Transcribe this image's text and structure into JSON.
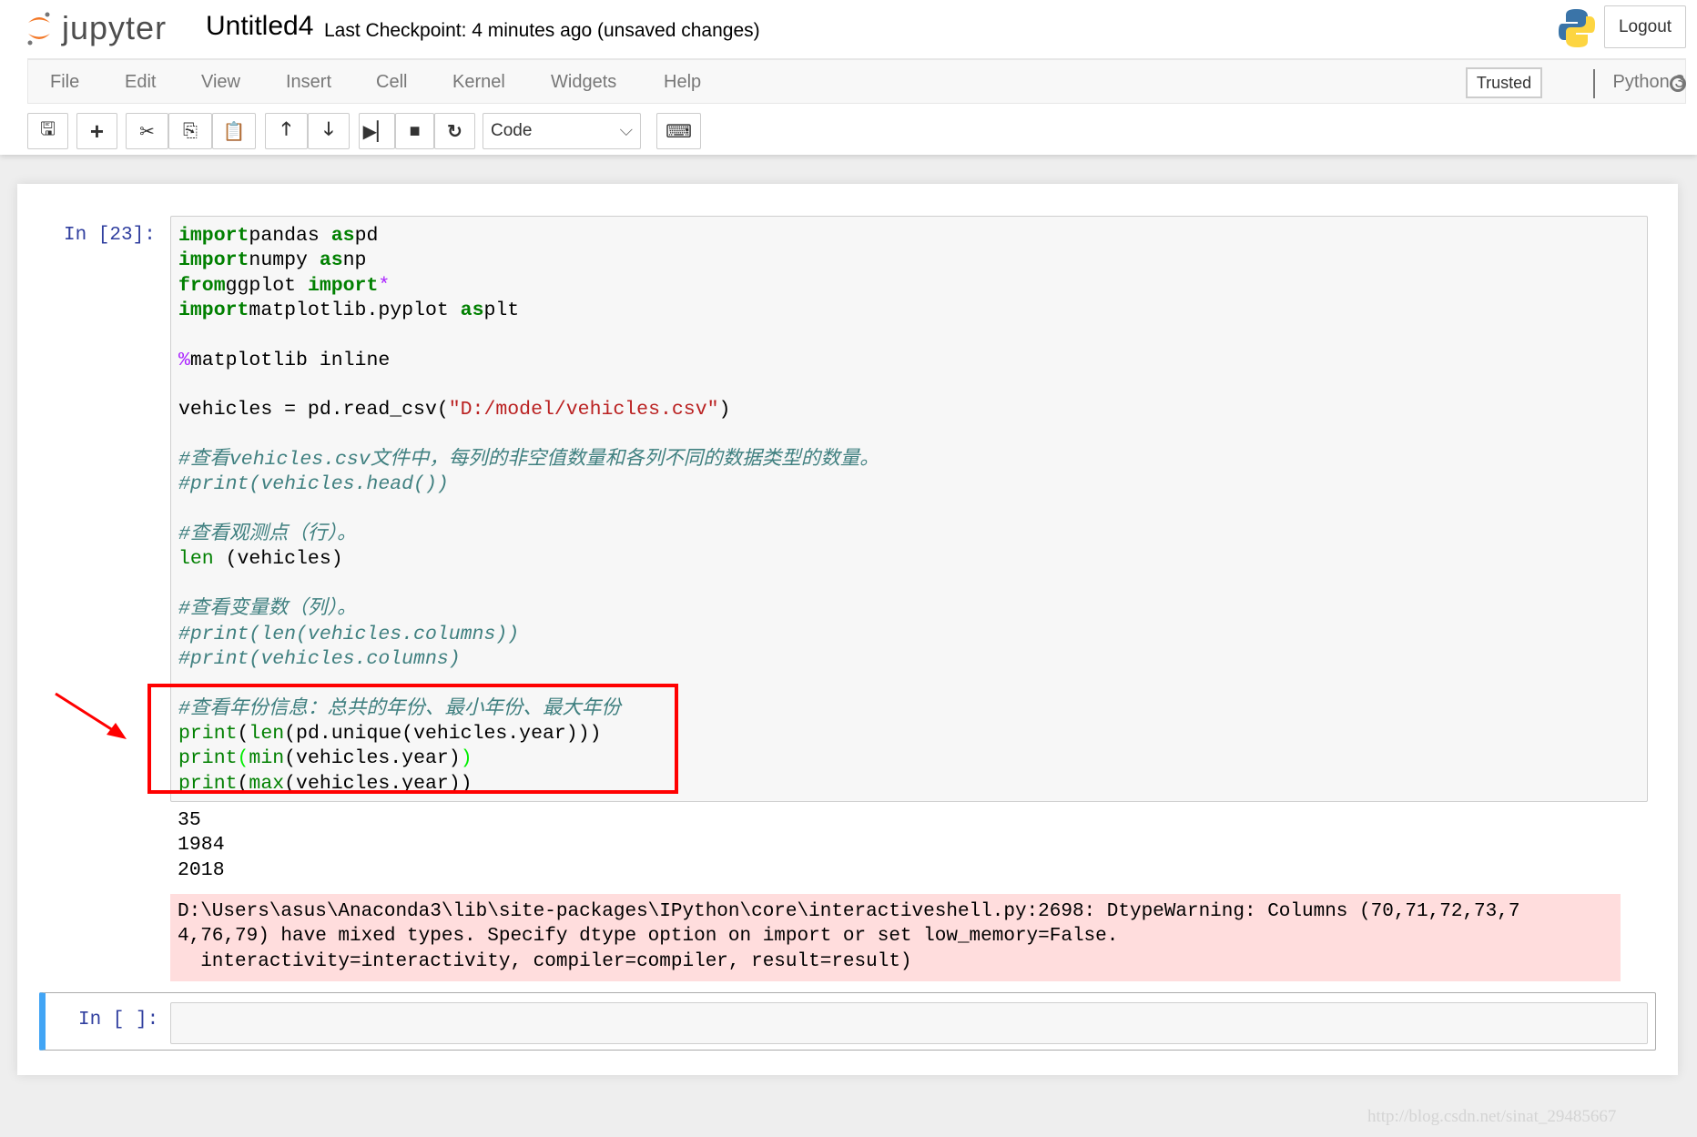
{
  "header": {
    "logo_text": "jupyter",
    "notebook_title": "Untitled4",
    "checkpoint": "Last Checkpoint: 4 minutes ago (unsaved changes)",
    "logout": "Logout"
  },
  "menu": [
    "File",
    "Edit",
    "View",
    "Insert",
    "Cell",
    "Kernel",
    "Widgets",
    "Help"
  ],
  "kernel": {
    "trusted": "Trusted",
    "name": "Python 3",
    "status": "idle"
  },
  "toolbar": {
    "buttons": [
      "save-icon",
      "plus-icon",
      "cut-icon",
      "copy-icon",
      "paste-icon",
      "arrow-up-icon",
      "arrow-down-icon",
      "run-icon",
      "stop-icon",
      "restart-icon",
      "keyboard-icon"
    ],
    "cell_type": "Code"
  },
  "cells": [
    {
      "prompt": "In [23]:",
      "code": [
        [
          [
            "kw",
            "import"
          ],
          [
            "",
            "pandas "
          ],
          [
            "kw",
            "as"
          ],
          [
            "",
            "pd"
          ]
        ],
        [
          [
            "kw",
            "import"
          ],
          [
            "",
            "numpy "
          ],
          [
            "kw",
            "as"
          ],
          [
            "",
            "np"
          ]
        ],
        [
          [
            "kw",
            "from"
          ],
          [
            "",
            "ggplot "
          ],
          [
            "kw",
            "import"
          ],
          [
            "mg",
            "*"
          ]
        ],
        [
          [
            "kw",
            "import"
          ],
          [
            "",
            "matplotlib.pyplot "
          ],
          [
            "kw",
            "as"
          ],
          [
            "",
            "plt"
          ]
        ],
        [],
        [
          [
            "mg",
            "%"
          ],
          [
            "",
            "matplotlib inline"
          ]
        ],
        [],
        [
          [
            "",
            "vehicles = pd.read_csv("
          ],
          [
            "st",
            "\"D:/model/vehicles.csv\""
          ],
          [
            "",
            ")"
          ]
        ],
        [],
        [
          [
            "cm",
            "#查看vehicles.csv文件中，每列的非空值数量和各列不同的数据类型的数量。"
          ]
        ],
        [
          [
            "cm",
            "#print(vehicles.head())"
          ]
        ],
        [],
        [
          [
            "cm",
            "#查看观测点（行）。"
          ]
        ],
        [
          [
            "bi",
            "len"
          ],
          [
            "",
            " (vehicles)"
          ]
        ],
        [],
        [
          [
            "cm",
            "#查看变量数（列）。"
          ]
        ],
        [
          [
            "cm",
            "#print(len(vehicles.columns))"
          ]
        ],
        [
          [
            "cm",
            "#print(vehicles.columns)"
          ]
        ],
        [],
        [
          [
            "cm",
            "#查看年份信息：总共的年份、最小年份、最大年份"
          ]
        ],
        [
          [
            "bi",
            "print"
          ],
          [
            "",
            "("
          ],
          [
            "bi",
            "len"
          ],
          [
            "",
            "(pd.unique(vehicles.year)))"
          ]
        ],
        [
          [
            "bi",
            "print"
          ],
          [
            "br",
            "("
          ],
          [
            "bi",
            "min"
          ],
          [
            "",
            "(vehicles.year)"
          ],
          [
            "br",
            ")"
          ]
        ],
        [
          [
            "bi",
            "print"
          ],
          [
            "",
            "("
          ],
          [
            "bi",
            "max"
          ],
          [
            "",
            "(vehicles.year))"
          ]
        ]
      ],
      "stdout": [
        "35",
        "1984",
        "2018"
      ],
      "stderr": [
        "D:\\Users\\asus\\Anaconda3\\lib\\site-packages\\IPython\\core\\interactiveshell.py:2698: DtypeWarning: Columns (70,71,72,73,7",
        "4,76,79) have mixed types. Specify dtype option on import or set low_memory=False.",
        "  interactivity=interactivity, compiler=compiler, result=result)"
      ]
    },
    {
      "prompt": "In [ ]:",
      "code": []
    }
  ],
  "watermark": "http://blog.csdn.net/sinat_29485667",
  "colors": {
    "annotation": "#ff0000",
    "selected_cell": "#42a5f5"
  }
}
